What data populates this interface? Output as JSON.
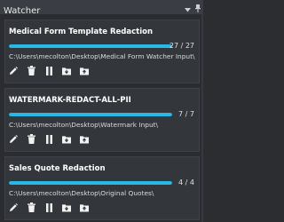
{
  "window": {
    "title": "Watcher"
  },
  "colors": {
    "accent": "#27b8e6",
    "card_bg": "#33363b",
    "window_bg": "#2a2c31"
  },
  "watchers": [
    {
      "name": "Medical Form Template Redaction",
      "count": "27 / 27",
      "progress": 1.0,
      "path": "C:\\Users\\mecolton\\Desktop\\Medical Form Watcher Input\\",
      "actions": [
        "edit-icon",
        "trash-icon",
        "pause-icon",
        "folder-download-icon",
        "folder-upload-icon"
      ]
    },
    {
      "name": "WATERMARK-REDACT-ALL-PII",
      "count": "7 / 7",
      "progress": 1.0,
      "path": "C:\\Users\\mecolton\\Desktop\\Watermark Input\\",
      "actions": [
        "edit-icon",
        "trash-icon",
        "pause-icon",
        "folder-download-icon",
        "folder-upload-icon"
      ]
    },
    {
      "name": "Sales Quote Redaction",
      "count": "4 / 4",
      "progress": 1.0,
      "path": "C:\\Users\\mecolton\\Desktop\\Original Quotes\\",
      "actions": [
        "edit-icon",
        "trash-icon",
        "pause-icon",
        "folder-download-icon",
        "folder-upload-icon"
      ]
    }
  ]
}
